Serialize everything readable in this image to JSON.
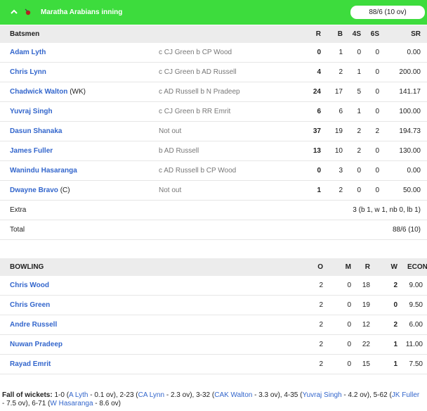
{
  "header": {
    "title": "Maratha Arabians inning",
    "score": "88/6 (10 ov)"
  },
  "batting_headers": {
    "batsmen": "Batsmen",
    "r": "R",
    "b": "B",
    "fours": "4S",
    "sixes": "6S",
    "sr": "SR"
  },
  "batsmen": [
    {
      "name": "Adam Lyth",
      "role": "",
      "dismissal": "c CJ Green b CP Wood",
      "r": "0",
      "b": "1",
      "fours": "0",
      "sixes": "0",
      "sr": "0.00"
    },
    {
      "name": "Chris Lynn",
      "role": "",
      "dismissal": "c CJ Green b AD Russell",
      "r": "4",
      "b": "2",
      "fours": "1",
      "sixes": "0",
      "sr": "200.00"
    },
    {
      "name": "Chadwick Walton",
      "role": "(WK)",
      "dismissal": "c AD Russell b N Pradeep",
      "r": "24",
      "b": "17",
      "fours": "5",
      "sixes": "0",
      "sr": "141.17"
    },
    {
      "name": "Yuvraj Singh",
      "role": "",
      "dismissal": "c CJ Green b RR Emrit",
      "r": "6",
      "b": "6",
      "fours": "1",
      "sixes": "0",
      "sr": "100.00"
    },
    {
      "name": "Dasun Shanaka",
      "role": "",
      "dismissal": "Not out",
      "r": "37",
      "b": "19",
      "fours": "2",
      "sixes": "2",
      "sr": "194.73"
    },
    {
      "name": "James Fuller",
      "role": "",
      "dismissal": "b AD Russell",
      "r": "13",
      "b": "10",
      "fours": "2",
      "sixes": "0",
      "sr": "130.00"
    },
    {
      "name": "Wanindu Hasaranga",
      "role": "",
      "dismissal": "c AD Russell b CP Wood",
      "r": "0",
      "b": "3",
      "fours": "0",
      "sixes": "0",
      "sr": "0.00"
    },
    {
      "name": "Dwayne Bravo",
      "role": "(C)",
      "dismissal": "Not out",
      "r": "1",
      "b": "2",
      "fours": "0",
      "sixes": "0",
      "sr": "50.00"
    }
  ],
  "extra": {
    "label": "Extra",
    "value": "3 (b 1, w 1, nb 0, lb 1)"
  },
  "total": {
    "label": "Total",
    "value": "88/6 (10)"
  },
  "bowling_headers": {
    "bowling": "BOWLING",
    "o": "O",
    "m": "M",
    "r": "R",
    "w": "W",
    "econ": "ECON"
  },
  "bowlers": [
    {
      "name": "Chris Wood",
      "o": "2",
      "m": "0",
      "r": "18",
      "w": "2",
      "econ": "9.00"
    },
    {
      "name": "Chris Green",
      "o": "2",
      "m": "0",
      "r": "19",
      "w": "0",
      "econ": "9.50"
    },
    {
      "name": "Andre Russell",
      "o": "2",
      "m": "0",
      "r": "12",
      "w": "2",
      "econ": "6.00"
    },
    {
      "name": "Nuwan Pradeep",
      "o": "2",
      "m": "0",
      "r": "22",
      "w": "1",
      "econ": "11.00"
    },
    {
      "name": "Rayad Emrit",
      "o": "2",
      "m": "0",
      "r": "15",
      "w": "1",
      "econ": "7.50"
    }
  ],
  "fall_of_wickets": {
    "label": "Fall of wickets:",
    "items": [
      {
        "score": "1-0",
        "player": "A Lyth",
        "over": "0.1 ov"
      },
      {
        "score": "2-23",
        "player": "CA Lynn",
        "over": "2.3 ov"
      },
      {
        "score": "3-32",
        "player": "CAK Walton",
        "over": "3.3 ov"
      },
      {
        "score": "4-35",
        "player": "Yuvraj Singh",
        "over": "4.2 ov"
      },
      {
        "score": "5-62",
        "player": "JK Fuller",
        "over": "7.5 ov"
      },
      {
        "score": "6-71",
        "player": "W Hasaranga",
        "over": "8.6 ov"
      }
    ]
  },
  "colors": {
    "header_bg": "#3ddc3d",
    "link": "#3366cc",
    "row_header_bg": "#ececec"
  },
  "icons": {
    "collapse": "chevron-up-icon",
    "ball": "cricket-ball-icon"
  }
}
